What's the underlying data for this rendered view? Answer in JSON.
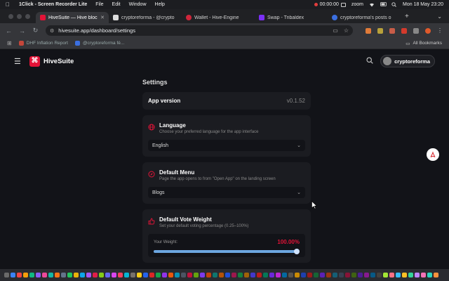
{
  "menubar": {
    "app_name": "1Click - Screen Recorder Lite",
    "items": [
      "File",
      "Edit",
      "Window",
      "Help"
    ],
    "timer": "00:00:00",
    "zoom": "zoom",
    "datetime": "Mon 18 May  23:20"
  },
  "tabs": [
    {
      "title": "HiveSuite — Hive blockch",
      "color": "#e31337",
      "active": true
    },
    {
      "title": "cryptoreforma - @crypto",
      "color": "#dddddd",
      "active": false
    },
    {
      "title": "Wallet - Hive-Engine",
      "color": "#d0263b",
      "active": false
    },
    {
      "title": "Swap - Tribaldex",
      "color": "#7b2ff7",
      "active": false
    },
    {
      "title": "cryptoreforma's posts o",
      "color": "#3b6fe0",
      "active": false
    }
  ],
  "address": {
    "url": "hivesuite.app/dashboard/settings"
  },
  "bookmarks": {
    "items": [
      {
        "label": "DHF Inflation Report",
        "color": "#c4463a"
      },
      {
        "label": "@cryptoreforma fé...",
        "color": "#3b6fe0"
      }
    ],
    "all_label": "All Bookmarks"
  },
  "app": {
    "brand": "HiveSuite",
    "brand_color": "#e31337",
    "username": "cryptoreforma"
  },
  "settings": {
    "title": "Settings",
    "app_version_label": "App version",
    "app_version_value": "v0.1.52",
    "language": {
      "title": "Language",
      "desc": "Choose your preferred language for the app interface",
      "value": "English"
    },
    "default_menu": {
      "title": "Default Menu",
      "desc": "Page the app opens to from \"Open App\" on the landing screen",
      "value": "Blogs"
    },
    "vote_weight": {
      "title": "Default Vote Weight",
      "desc": "Set your default voting percentage (0.25–100%)",
      "weight_label": "Your Weight:",
      "weight_value": "100.00%",
      "weight_percent": 100
    }
  },
  "icons": {
    "hamburger": "menu-icon",
    "search": "search-icon",
    "pdf": "pdf-icon",
    "globe": "globe-icon",
    "compass": "compass-icon",
    "thumbs_up": "thumbs-up-icon"
  }
}
